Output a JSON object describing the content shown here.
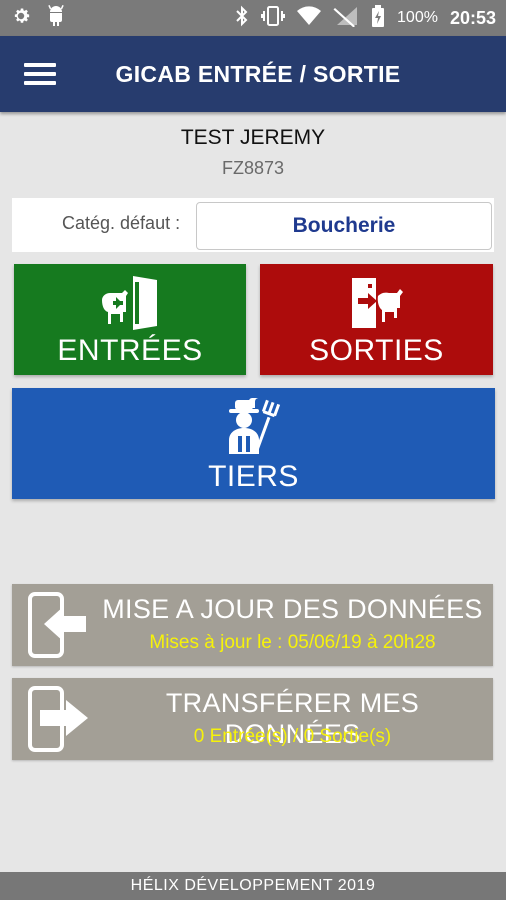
{
  "status_bar": {
    "icons_left": [
      "settings-icon",
      "android-icon"
    ],
    "icons_right": [
      "bluetooth-icon",
      "vibrate-icon",
      "wifi-icon",
      "signal-icon",
      "battery-icon"
    ],
    "battery": "100%",
    "time": "20:53"
  },
  "app_bar": {
    "title": "GICAB ENTRÉE / SORTIE",
    "color": "#273c6e"
  },
  "user": {
    "name": "TEST JEREMY",
    "code": "FZ8873"
  },
  "category": {
    "label": "Catég. défaut :",
    "value": "Boucherie"
  },
  "buttons": {
    "entrees": {
      "label": "ENTRÉES",
      "color": "#167a1f",
      "icon": "cow-entry-icon"
    },
    "sorties": {
      "label": "SORTIES",
      "color": "#ad0c0c",
      "icon": "cow-exit-icon"
    },
    "tiers": {
      "label": "TIERS",
      "color": "#1f5bb5",
      "icon": "farmer-icon"
    }
  },
  "sync": {
    "update": {
      "title": "MISE A JOUR DES DONNÉES",
      "subtitle": "Mises à jour le : 05/06/19 à 20h28",
      "icon": "phone-arrow-in-icon"
    },
    "transfer": {
      "title": "TRANSFÉRER MES DONNÉES",
      "subtitle": "0 Entrée(s) / 0 Sortie(s)",
      "icon": "phone-arrow-out-icon"
    }
  },
  "footer": {
    "text": "HÉLIX DÉVELOPPEMENT 2019"
  }
}
